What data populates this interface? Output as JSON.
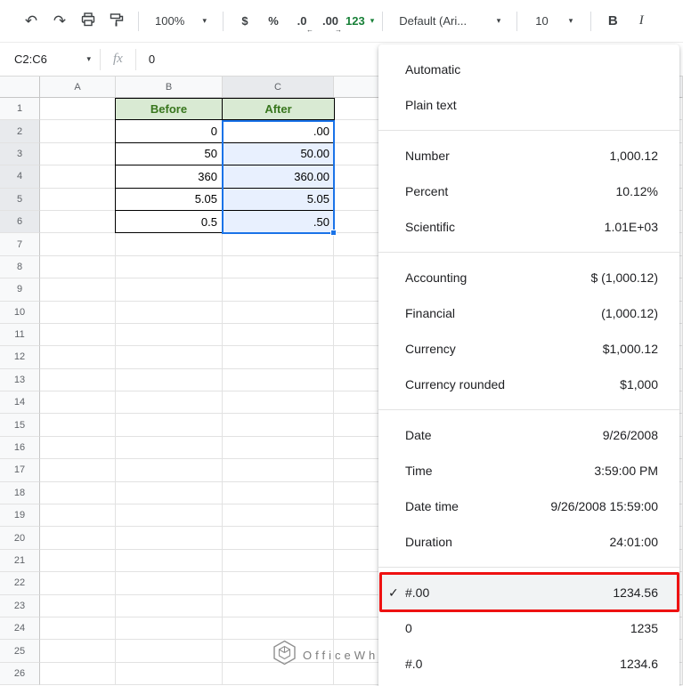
{
  "toolbar": {
    "zoom": "100%",
    "currency": "$",
    "percent": "%",
    "decrease_decimal": ".0",
    "increase_decimal": ".00",
    "more_formats": "123",
    "font": "Default (Ari...",
    "font_size": "10",
    "bold": "B",
    "italic": "I"
  },
  "formula_bar": {
    "name_box": "C2:C6",
    "fx_label": "fx",
    "value": "0"
  },
  "grid": {
    "column_headers": [
      "A",
      "B",
      "C",
      ""
    ],
    "row_count": 26,
    "table": {
      "headers": [
        "Before",
        "After"
      ],
      "rows": [
        [
          "0",
          ".00"
        ],
        [
          "50",
          "50.00"
        ],
        [
          "360",
          "360.00"
        ],
        [
          "5.05",
          "5.05"
        ],
        [
          "0.5",
          ".50"
        ]
      ]
    }
  },
  "menu": {
    "items": [
      {
        "label": "Automatic",
        "value": ""
      },
      {
        "label": "Plain text",
        "value": ""
      },
      {
        "divider": true
      },
      {
        "label": "Number",
        "value": "1,000.12"
      },
      {
        "label": "Percent",
        "value": "10.12%"
      },
      {
        "label": "Scientific",
        "value": "1.01E+03"
      },
      {
        "divider": true
      },
      {
        "label": "Accounting",
        "value": "$ (1,000.12)"
      },
      {
        "label": "Financial",
        "value": "(1,000.12)"
      },
      {
        "label": "Currency",
        "value": "$1,000.12"
      },
      {
        "label": "Currency rounded",
        "value": "$1,000"
      },
      {
        "divider": true
      },
      {
        "label": "Date",
        "value": "9/26/2008"
      },
      {
        "label": "Time",
        "value": "3:59:00 PM"
      },
      {
        "label": "Date time",
        "value": "9/26/2008 15:59:00"
      },
      {
        "label": "Duration",
        "value": "24:01:00"
      },
      {
        "divider": true
      },
      {
        "label": "#.00",
        "value": "1234.56",
        "checked": true,
        "highlighted": true
      },
      {
        "label": "0",
        "value": "1235"
      },
      {
        "label": "#.0",
        "value": "1234.6"
      }
    ]
  },
  "watermark": {
    "text": "OfficeWheel"
  },
  "colors": {
    "accent_green": "#188038",
    "selection_blue": "#1a73e8",
    "selection_fill": "#e8f0fe",
    "table_header_bg": "#d9ead3",
    "table_header_text": "#38761d",
    "annotation_red": "#ee1111",
    "menu_highlight": "#f1f3f4"
  }
}
